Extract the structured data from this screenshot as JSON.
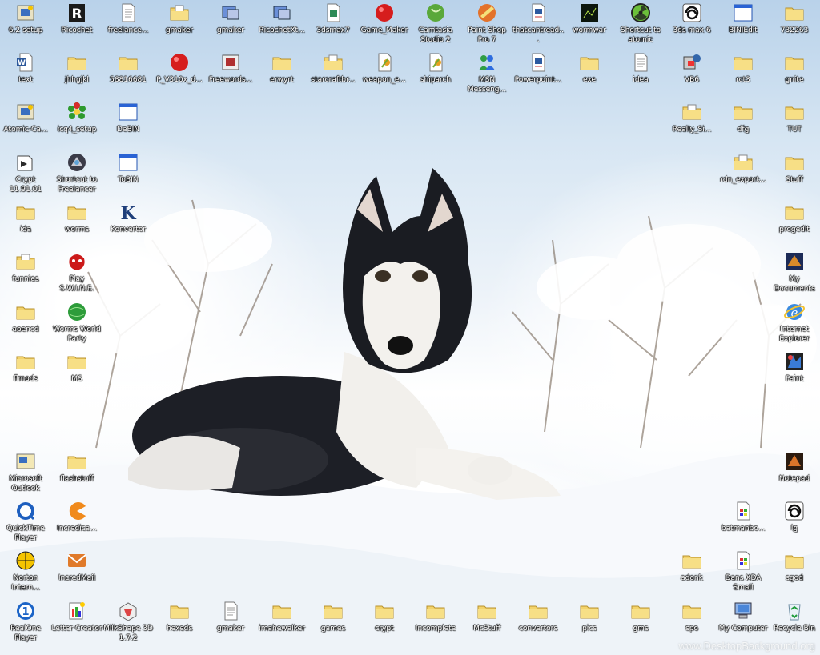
{
  "wallpaper": {
    "subject": "husky-dog-in-snow",
    "watermark": "www.DesktopBackground.org"
  },
  "icons": [
    {
      "label": "6.2 setup",
      "type": "setup"
    },
    {
      "label": "Ricochet",
      "type": "ricochet"
    },
    {
      "label": "freelance...",
      "type": "doc"
    },
    {
      "label": "gmaker",
      "type": "folder-file"
    },
    {
      "label": "gmaker",
      "type": "setup-blue"
    },
    {
      "label": "RicochetXt...",
      "type": "setup-blue"
    },
    {
      "label": "3dsmax7",
      "type": "doc-green"
    },
    {
      "label": "Game_Maker",
      "type": "red-ball"
    },
    {
      "label": "Camtasia Studio 2",
      "type": "green-ball"
    },
    {
      "label": "Paint Shop Pro 7",
      "type": "psp"
    },
    {
      "label": "thatcantread...",
      "type": "ppt-doc"
    },
    {
      "label": "wormwar",
      "type": "black-square"
    },
    {
      "label": "Shortcut to atomic",
      "type": "radioactive"
    },
    {
      "label": "3ds max 6",
      "type": "max"
    },
    {
      "label": "BINIEdit",
      "type": "window"
    },
    {
      "label": "732263",
      "type": "folder"
    },
    {
      "label": "text",
      "type": "word"
    },
    {
      "label": "jhhgjkl",
      "type": "folder"
    },
    {
      "label": "58816681",
      "type": "folder"
    },
    {
      "label": "P_V310x_d...",
      "type": "red-ball"
    },
    {
      "label": "Freewords...",
      "type": "film"
    },
    {
      "label": "erwyrt",
      "type": "folder"
    },
    {
      "label": "starcraftbr...",
      "type": "folder-file"
    },
    {
      "label": "weapon_e...",
      "type": "paint-doc"
    },
    {
      "label": "shiparch",
      "type": "paint-doc"
    },
    {
      "label": "MSN Messeng...",
      "type": "msn"
    },
    {
      "label": "Powerpoint...",
      "type": "ppt-doc"
    },
    {
      "label": "exe",
      "type": "folder"
    },
    {
      "label": "idea",
      "type": "doc"
    },
    {
      "label": "VB6",
      "type": "vb"
    },
    {
      "label": "rct3",
      "type": "folder"
    },
    {
      "label": "gnite",
      "type": "folder"
    },
    {
      "label": "Atomic-Ca...",
      "type": "setup"
    },
    {
      "label": "icq4_setup",
      "type": "icq"
    },
    {
      "label": "DeBIN",
      "type": "window"
    },
    {
      "label": "Really_Si...",
      "type": "folder-file"
    },
    {
      "label": "dfg",
      "type": "folder"
    },
    {
      "label": "TUT",
      "type": "folder"
    },
    {
      "label": "Crypt 11.91.01",
      "type": "folder-open"
    },
    {
      "label": "Shortcut to Freelancer",
      "type": "freelancer"
    },
    {
      "label": "ToBIN",
      "type": "window"
    },
    {
      "label": "rdn_export...",
      "type": "folder-file"
    },
    {
      "label": "Stuff",
      "type": "folder"
    },
    {
      "label": "ida",
      "type": "folder"
    },
    {
      "label": "worms",
      "type": "folder"
    },
    {
      "label": "Konvertor",
      "type": "konvertor"
    },
    {
      "label": "progedit",
      "type": "folder"
    },
    {
      "label": "funnies",
      "type": "folder-file"
    },
    {
      "label": "Play S.W.I.N.E.",
      "type": "swine"
    },
    {
      "label": "My Documents",
      "type": "mydocs"
    },
    {
      "label": "aoencd",
      "type": "folder"
    },
    {
      "label": "Worms World Party",
      "type": "globe-green"
    },
    {
      "label": "Internet Explorer",
      "type": "ie"
    },
    {
      "label": "flmods",
      "type": "folder"
    },
    {
      "label": "MS",
      "type": "folder"
    },
    {
      "label": "Paint",
      "type": "paint"
    },
    {
      "label": "Microsoft Outlook",
      "type": "outlook"
    },
    {
      "label": "flashstuff",
      "type": "folder"
    },
    {
      "label": "Notepad",
      "type": "notepad"
    },
    {
      "label": "QuickTime Player",
      "type": "quicktime"
    },
    {
      "label": "Incredica...",
      "type": "pacman"
    },
    {
      "label": "batmanbo...",
      "type": "setup-doc"
    },
    {
      "label": "lg",
      "type": "max"
    },
    {
      "label": "Norton Intern...",
      "type": "norton"
    },
    {
      "label": "IncredMail",
      "type": "incredimail"
    },
    {
      "label": "adonk",
      "type": "folder"
    },
    {
      "label": "Dans XDA Small",
      "type": "setup-doc"
    },
    {
      "label": "sgod",
      "type": "folder"
    },
    {
      "label": "RealOne Player",
      "type": "realone"
    },
    {
      "label": "Letter Creator",
      "type": "letter"
    },
    {
      "label": "MilkShape 3D 1.7.2",
      "type": "milkshape"
    },
    {
      "label": "hexeds",
      "type": "folder"
    },
    {
      "label": "gmaker",
      "type": "doc"
    },
    {
      "label": "imahewalker",
      "type": "folder"
    },
    {
      "label": "games",
      "type": "folder"
    },
    {
      "label": "crypt",
      "type": "folder"
    },
    {
      "label": "Incomplete",
      "type": "folder"
    },
    {
      "label": "McStuff",
      "type": "folder"
    },
    {
      "label": "convertors",
      "type": "folder"
    },
    {
      "label": "pics",
      "type": "folder"
    },
    {
      "label": "gms",
      "type": "folder"
    },
    {
      "label": "spo",
      "type": "folder"
    },
    {
      "label": "My Computer",
      "type": "mycomputer"
    },
    {
      "label": "Recycle Bin",
      "type": "recycle"
    }
  ]
}
